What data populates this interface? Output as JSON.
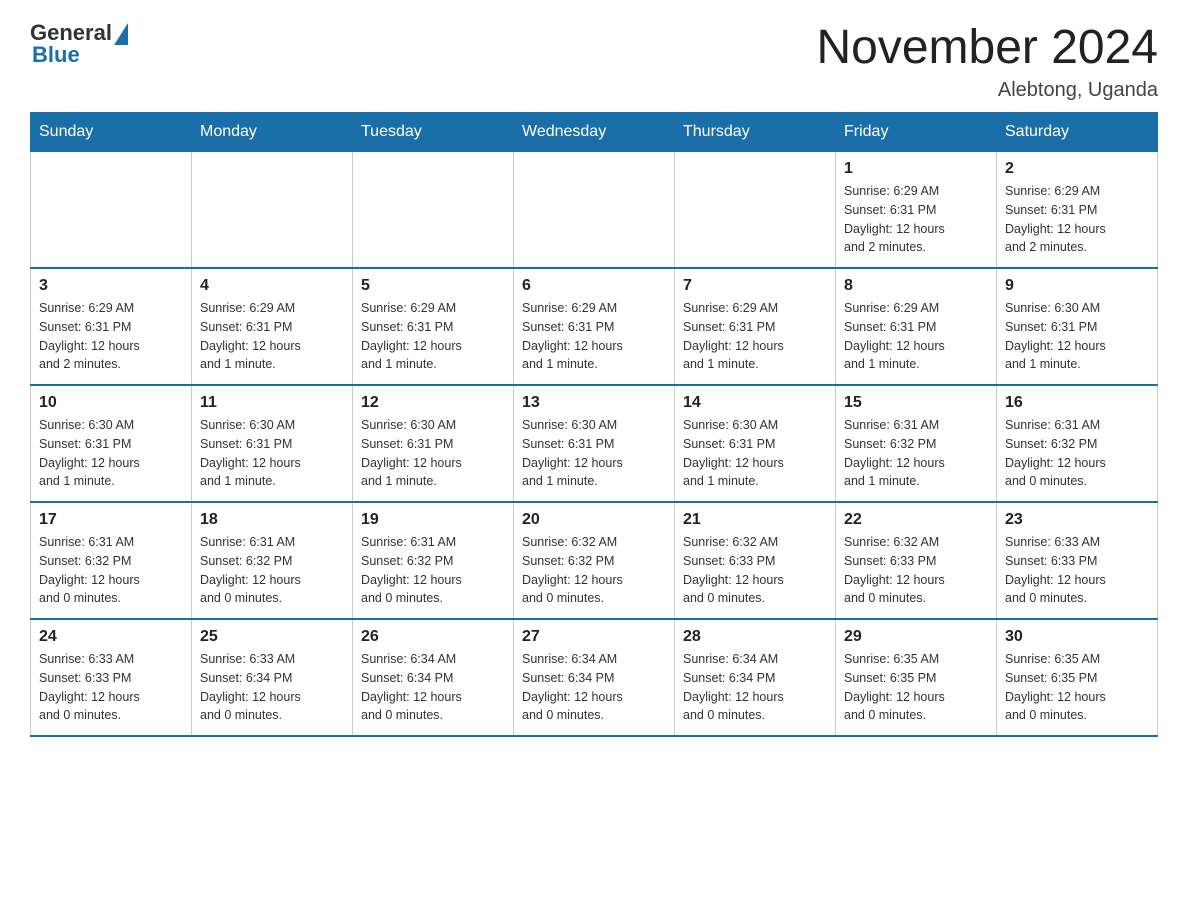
{
  "header": {
    "logo_general": "General",
    "logo_blue": "Blue",
    "month_title": "November 2024",
    "location": "Alebtong, Uganda"
  },
  "weekdays": [
    "Sunday",
    "Monday",
    "Tuesday",
    "Wednesday",
    "Thursday",
    "Friday",
    "Saturday"
  ],
  "weeks": [
    [
      {
        "day": "",
        "info": ""
      },
      {
        "day": "",
        "info": ""
      },
      {
        "day": "",
        "info": ""
      },
      {
        "day": "",
        "info": ""
      },
      {
        "day": "",
        "info": ""
      },
      {
        "day": "1",
        "info": "Sunrise: 6:29 AM\nSunset: 6:31 PM\nDaylight: 12 hours\nand 2 minutes."
      },
      {
        "day": "2",
        "info": "Sunrise: 6:29 AM\nSunset: 6:31 PM\nDaylight: 12 hours\nand 2 minutes."
      }
    ],
    [
      {
        "day": "3",
        "info": "Sunrise: 6:29 AM\nSunset: 6:31 PM\nDaylight: 12 hours\nand 2 minutes."
      },
      {
        "day": "4",
        "info": "Sunrise: 6:29 AM\nSunset: 6:31 PM\nDaylight: 12 hours\nand 1 minute."
      },
      {
        "day": "5",
        "info": "Sunrise: 6:29 AM\nSunset: 6:31 PM\nDaylight: 12 hours\nand 1 minute."
      },
      {
        "day": "6",
        "info": "Sunrise: 6:29 AM\nSunset: 6:31 PM\nDaylight: 12 hours\nand 1 minute."
      },
      {
        "day": "7",
        "info": "Sunrise: 6:29 AM\nSunset: 6:31 PM\nDaylight: 12 hours\nand 1 minute."
      },
      {
        "day": "8",
        "info": "Sunrise: 6:29 AM\nSunset: 6:31 PM\nDaylight: 12 hours\nand 1 minute."
      },
      {
        "day": "9",
        "info": "Sunrise: 6:30 AM\nSunset: 6:31 PM\nDaylight: 12 hours\nand 1 minute."
      }
    ],
    [
      {
        "day": "10",
        "info": "Sunrise: 6:30 AM\nSunset: 6:31 PM\nDaylight: 12 hours\nand 1 minute."
      },
      {
        "day": "11",
        "info": "Sunrise: 6:30 AM\nSunset: 6:31 PM\nDaylight: 12 hours\nand 1 minute."
      },
      {
        "day": "12",
        "info": "Sunrise: 6:30 AM\nSunset: 6:31 PM\nDaylight: 12 hours\nand 1 minute."
      },
      {
        "day": "13",
        "info": "Sunrise: 6:30 AM\nSunset: 6:31 PM\nDaylight: 12 hours\nand 1 minute."
      },
      {
        "day": "14",
        "info": "Sunrise: 6:30 AM\nSunset: 6:31 PM\nDaylight: 12 hours\nand 1 minute."
      },
      {
        "day": "15",
        "info": "Sunrise: 6:31 AM\nSunset: 6:32 PM\nDaylight: 12 hours\nand 1 minute."
      },
      {
        "day": "16",
        "info": "Sunrise: 6:31 AM\nSunset: 6:32 PM\nDaylight: 12 hours\nand 0 minutes."
      }
    ],
    [
      {
        "day": "17",
        "info": "Sunrise: 6:31 AM\nSunset: 6:32 PM\nDaylight: 12 hours\nand 0 minutes."
      },
      {
        "day": "18",
        "info": "Sunrise: 6:31 AM\nSunset: 6:32 PM\nDaylight: 12 hours\nand 0 minutes."
      },
      {
        "day": "19",
        "info": "Sunrise: 6:31 AM\nSunset: 6:32 PM\nDaylight: 12 hours\nand 0 minutes."
      },
      {
        "day": "20",
        "info": "Sunrise: 6:32 AM\nSunset: 6:32 PM\nDaylight: 12 hours\nand 0 minutes."
      },
      {
        "day": "21",
        "info": "Sunrise: 6:32 AM\nSunset: 6:33 PM\nDaylight: 12 hours\nand 0 minutes."
      },
      {
        "day": "22",
        "info": "Sunrise: 6:32 AM\nSunset: 6:33 PM\nDaylight: 12 hours\nand 0 minutes."
      },
      {
        "day": "23",
        "info": "Sunrise: 6:33 AM\nSunset: 6:33 PM\nDaylight: 12 hours\nand 0 minutes."
      }
    ],
    [
      {
        "day": "24",
        "info": "Sunrise: 6:33 AM\nSunset: 6:33 PM\nDaylight: 12 hours\nand 0 minutes."
      },
      {
        "day": "25",
        "info": "Sunrise: 6:33 AM\nSunset: 6:34 PM\nDaylight: 12 hours\nand 0 minutes."
      },
      {
        "day": "26",
        "info": "Sunrise: 6:34 AM\nSunset: 6:34 PM\nDaylight: 12 hours\nand 0 minutes."
      },
      {
        "day": "27",
        "info": "Sunrise: 6:34 AM\nSunset: 6:34 PM\nDaylight: 12 hours\nand 0 minutes."
      },
      {
        "day": "28",
        "info": "Sunrise: 6:34 AM\nSunset: 6:34 PM\nDaylight: 12 hours\nand 0 minutes."
      },
      {
        "day": "29",
        "info": "Sunrise: 6:35 AM\nSunset: 6:35 PM\nDaylight: 12 hours\nand 0 minutes."
      },
      {
        "day": "30",
        "info": "Sunrise: 6:35 AM\nSunset: 6:35 PM\nDaylight: 12 hours\nand 0 minutes."
      }
    ]
  ]
}
